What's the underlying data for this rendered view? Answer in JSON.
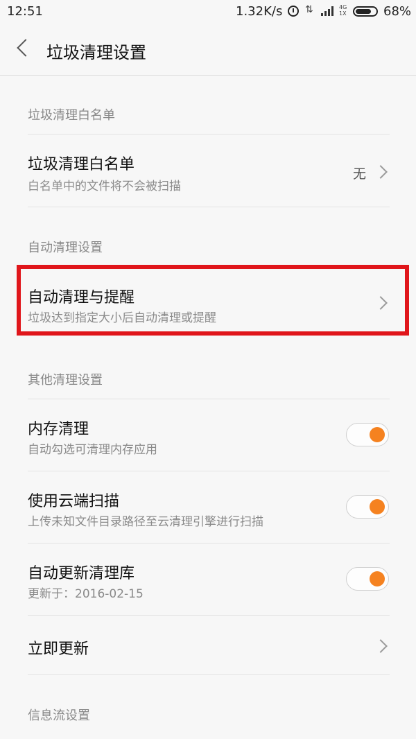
{
  "status": {
    "time": "12:51",
    "speed": "1.32K/s",
    "net_top": "4G",
    "net_bottom": "1X",
    "battery": "68%"
  },
  "header": {
    "title": "垃圾清理设置"
  },
  "sections": {
    "whitelist": "垃圾清理白名单",
    "auto": "自动清理设置",
    "other": "其他清理设置",
    "feed": "信息流设置"
  },
  "rows": {
    "whitelist": {
      "title": "垃圾清理白名单",
      "subtitle": "白名单中的文件将不会被扫描",
      "value": "无"
    },
    "auto_clean": {
      "title": "自动清理与提醒",
      "subtitle": "垃圾达到指定大小后自动清理或提醒"
    },
    "memory": {
      "title": "内存清理",
      "subtitle": "自动勾选可清理内存应用",
      "enabled": true
    },
    "cloud": {
      "title": "使用云端扫描",
      "subtitle": "上传未知文件目录路径至云清理引擎进行扫描",
      "enabled": true
    },
    "update_lib": {
      "title": "自动更新清理库",
      "subtitle": "更新于：2016-02-15",
      "enabled": true
    },
    "update_now": {
      "title": "立即更新"
    }
  },
  "accent": "#f58220",
  "highlight_color": "#e0161b"
}
